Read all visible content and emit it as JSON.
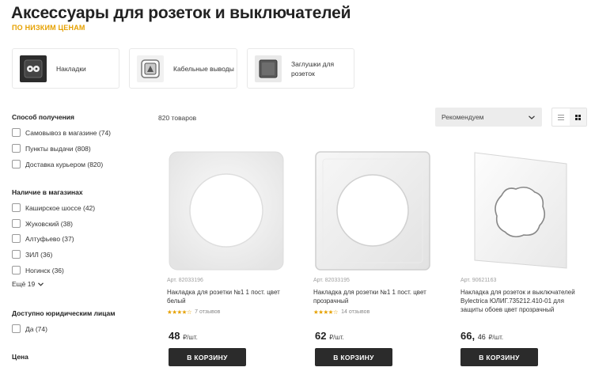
{
  "header": {
    "title": "Аксессуары для розеток и выключателей",
    "subtitle": "ПО НИЗКИМ ЦЕНАМ"
  },
  "categories": [
    {
      "label": "Накладки",
      "icon": "double-frame-icon"
    },
    {
      "label": "Кабельные выводы",
      "icon": "cable-outlet-icon"
    },
    {
      "label": "Заглушки для розеток",
      "icon": "blank-plate-icon"
    }
  ],
  "filters": {
    "delivery": {
      "title": "Способ получения",
      "options": [
        "Самовывоз в магазине (74)",
        "Пункты выдачи (808)",
        "Доставка курьером (820)"
      ]
    },
    "stores": {
      "title": "Наличие в магазинах",
      "options": [
        "Каширское шоссе (42)",
        "Жуковский (38)",
        "Алтуфьево (37)",
        "ЗИЛ (36)",
        "Ногинск (36)"
      ],
      "more": "Ещё 19"
    },
    "legal": {
      "title": "Доступно юридическим лицам",
      "options": [
        "Да (74)"
      ]
    },
    "price": {
      "title": "Цена"
    }
  },
  "toolbar": {
    "count": "820 товаров",
    "sort": "Рекомендуем"
  },
  "products": [
    {
      "art": "Арт. 82033196",
      "name": "Накладка для розетки №1 1 пост. цвет белый",
      "stars": "★★★★☆",
      "reviews": "7 отзывов",
      "price": "48",
      "cents": "",
      "unit": "₽/шт.",
      "button": "В КОРЗИНУ"
    },
    {
      "art": "Арт. 82033195",
      "name": "Накладка для розетки №1 1 пост. цвет прозрачный",
      "stars": "★★★★☆",
      "reviews": "14 отзывов",
      "price": "62",
      "cents": "",
      "unit": "₽/шт.",
      "button": "В КОРЗИНУ"
    },
    {
      "art": "Арт. 90621163",
      "name": "Накладка для розеток и выключателей Bylectrica ЮЛИГ.735212.410-01 для защиты обоев цвет прозрачный",
      "stars": "",
      "reviews": "",
      "price": "66,",
      "cents": "46",
      "unit": "₽/шт.",
      "button": "В КОРЗИНУ"
    }
  ],
  "colors": {
    "accent": "#e6a100",
    "button": "#2b2b2b"
  }
}
